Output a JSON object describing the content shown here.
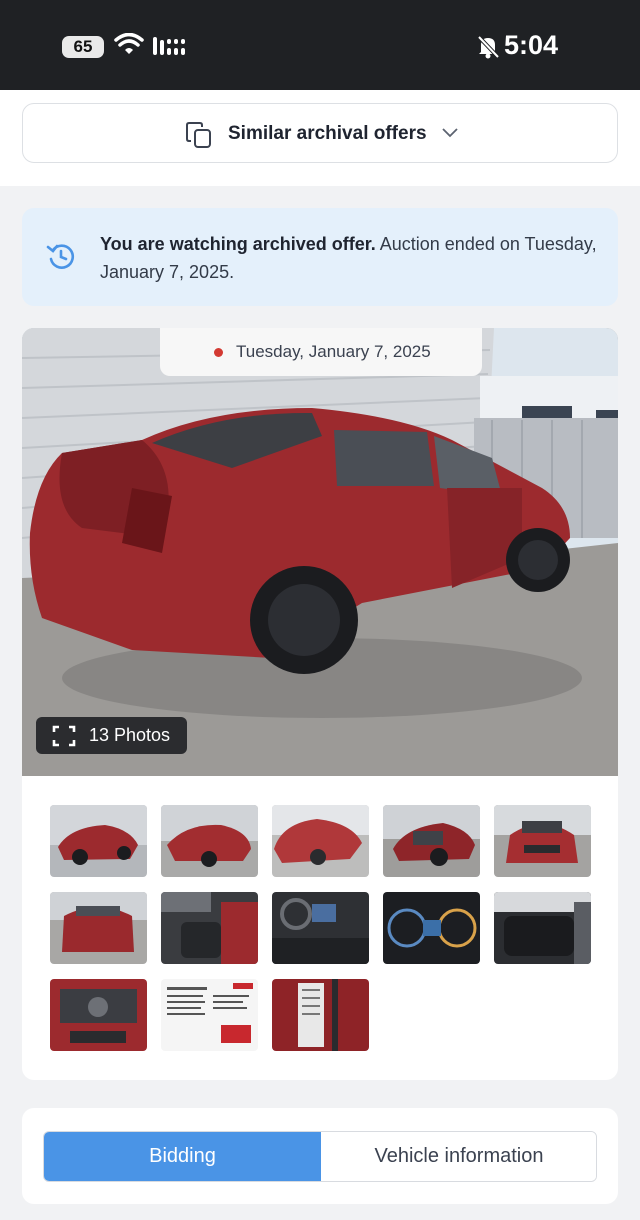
{
  "status_bar": {
    "battery": "65",
    "time": "5:04"
  },
  "similar_offers": {
    "label": "Similar archival offers"
  },
  "notice": {
    "bold": "You are watching archived offer.",
    "rest": " Auction ended on Tuesday, January 7, 2025."
  },
  "gallery": {
    "date": "Tuesday, January 7, 2025",
    "photos_label": "13 Photos",
    "thumbnails": [
      "exterior-front-left",
      "exterior-rear-right",
      "exterior-rear-left",
      "exterior-side-damage",
      "exterior-front",
      "exterior-rear",
      "interior-front-seats",
      "interior-dashboard",
      "instrument-cluster",
      "interior-rear-seats",
      "engine-bay",
      "window-sticker",
      "door-label"
    ]
  },
  "tabs": {
    "bidding": "Bidding",
    "vehicle_information": "Vehicle information"
  },
  "colors": {
    "accent": "#4a94e6",
    "notice_bg": "#e4f0fb",
    "car_red": "#9c2a2e",
    "status_dot": "#d33a32"
  }
}
